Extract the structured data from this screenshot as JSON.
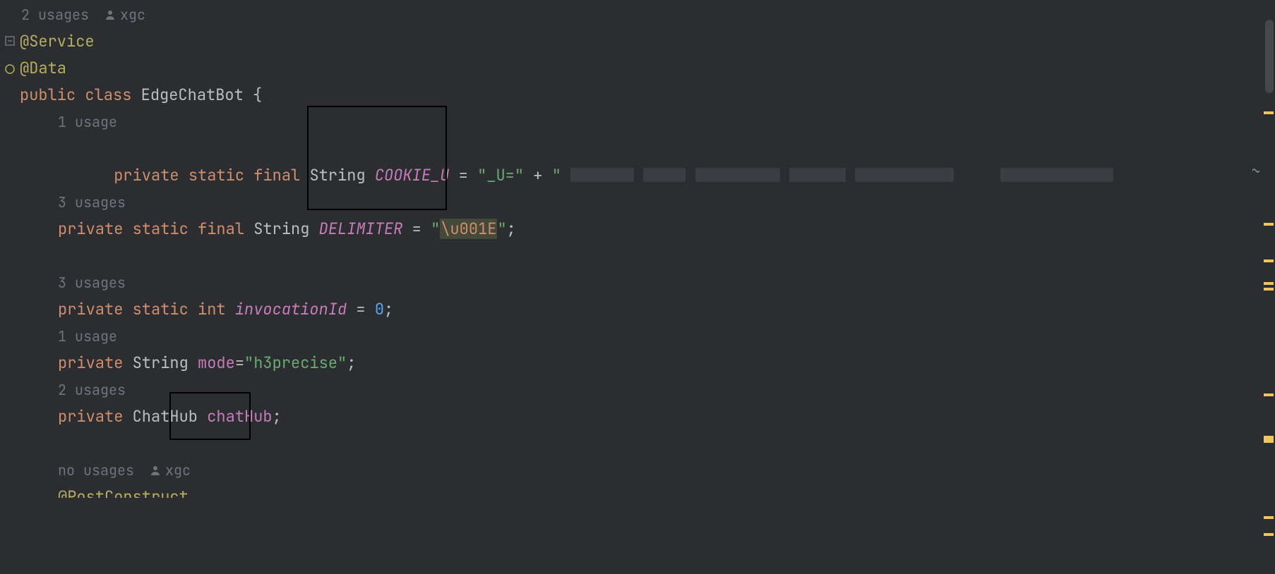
{
  "hints": {
    "class_usages": "2 usages",
    "class_author": "xgc",
    "cookie_usages": "1 usage",
    "delimiter_usages": "3 usages",
    "invocation_usages": "3 usages",
    "mode_usages": "1 usage",
    "chathub_usages": "2 usages",
    "postconstruct_usages": "no usages",
    "postconstruct_author": "xgc"
  },
  "code": {
    "anno_service": "@Service",
    "anno_data": "@Data",
    "kw_public": "public",
    "kw_class": "class",
    "class_name": "EdgeChatBot",
    "brace_open": "{",
    "kw_private": "private",
    "kw_static": "static",
    "kw_final": "final",
    "kw_int": "int",
    "type_string": "String",
    "type_chathub": "ChatHub",
    "field_cookie": "COOKIE_U",
    "field_delimiter": "DELIMITER",
    "field_invocation": "invocationId",
    "field_mode": "mode",
    "field_chathub": "chatHub",
    "eq": " = ",
    "eq_tight": "=",
    "str_u_prefix": "\"_U=\"",
    "plus": " + ",
    "str_open_quote": "\"",
    "str_delimiter_open": "\"",
    "esc_u001e": "\\u001E",
    "str_delimiter_close": "\"",
    "semicolon": ";",
    "num_zero": "0",
    "str_h3precise": "\"h3precise\"",
    "anno_postconstruct": "@PostConstruct"
  },
  "colors": {
    "keyword": "#cf8e6d",
    "annotation": "#b3ae60",
    "field": "#c77dbb",
    "string": "#6aab73",
    "number": "#56a8f5",
    "hint": "#6f737a"
  }
}
